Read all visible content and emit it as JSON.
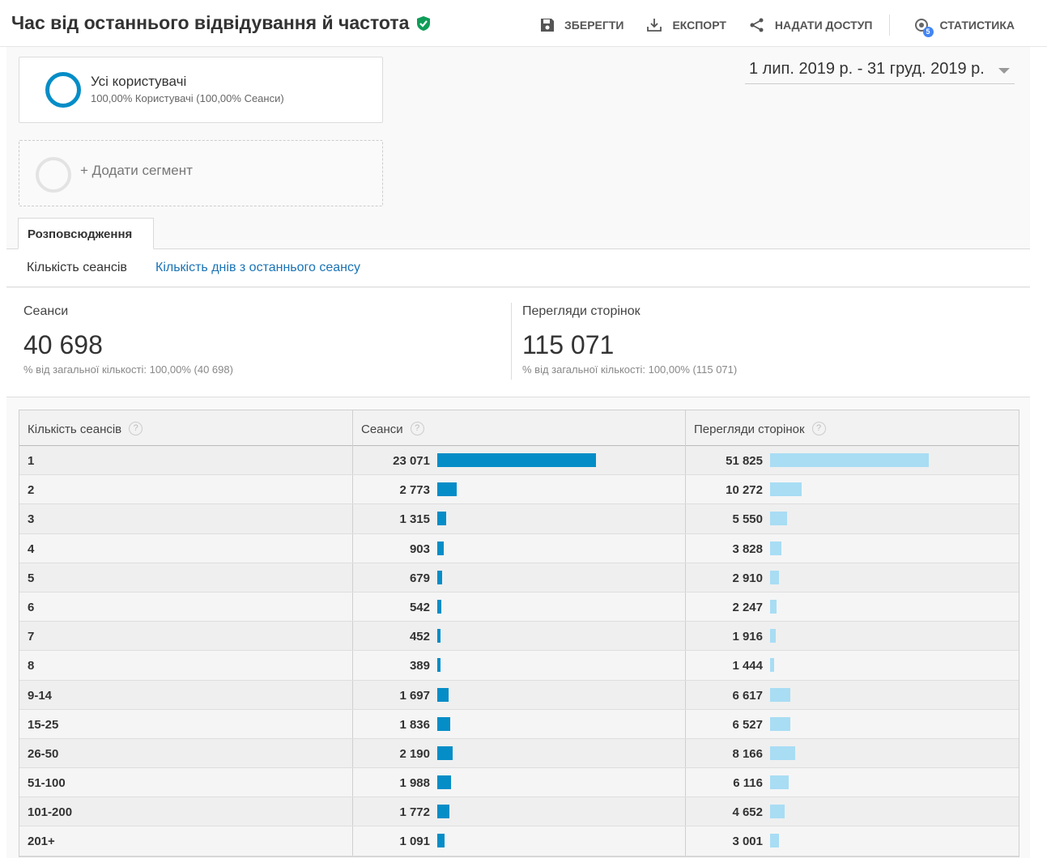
{
  "header": {
    "title": "Час від останнього відвідування й частота",
    "toolbar": {
      "save": "ЗБЕРЕГТИ",
      "export": "ЕКСПОРТ",
      "share": "НАДАТИ ДОСТУП",
      "insights": "СТАТИСТИКА",
      "insights_badge": "5"
    }
  },
  "segments": {
    "active": {
      "name": "Усі користувачі",
      "detail": "100,00% Користувачі (100,00% Сеанси)"
    },
    "add_label": "+ Додати сегмент"
  },
  "date_range": "1 лип. 2019 р. - 31 груд. 2019 р.",
  "tabs": {
    "active": "Розповсюдження"
  },
  "subnav": {
    "current": "Кількість сеансів",
    "link": "Кількість днів з останнього сеансу"
  },
  "scorecards": {
    "sessions": {
      "label": "Сеанси",
      "value": "40 698",
      "pct": "% від загальної кількості: 100,00% (40 698)"
    },
    "pageviews": {
      "label": "Перегляди сторінок",
      "value": "115 071",
      "pct": "% від загальної кількості: 100,00% (115 071)"
    }
  },
  "table": {
    "headers": [
      "Кількість сеансів",
      "Сеанси",
      "Перегляди сторінок"
    ],
    "help_glyph": "?",
    "rows": [
      {
        "label": "1",
        "sessions": "23 071",
        "sessions_v": 23071,
        "pageviews": "51 825",
        "pageviews_v": 51825
      },
      {
        "label": "2",
        "sessions": "2 773",
        "sessions_v": 2773,
        "pageviews": "10 272",
        "pageviews_v": 10272
      },
      {
        "label": "3",
        "sessions": "1 315",
        "sessions_v": 1315,
        "pageviews": "5 550",
        "pageviews_v": 5550
      },
      {
        "label": "4",
        "sessions": "903",
        "sessions_v": 903,
        "pageviews": "3 828",
        "pageviews_v": 3828
      },
      {
        "label": "5",
        "sessions": "679",
        "sessions_v": 679,
        "pageviews": "2 910",
        "pageviews_v": 2910
      },
      {
        "label": "6",
        "sessions": "542",
        "sessions_v": 542,
        "pageviews": "2 247",
        "pageviews_v": 2247
      },
      {
        "label": "7",
        "sessions": "452",
        "sessions_v": 452,
        "pageviews": "1 916",
        "pageviews_v": 1916
      },
      {
        "label": "8",
        "sessions": "389",
        "sessions_v": 389,
        "pageviews": "1 444",
        "pageviews_v": 1444
      },
      {
        "label": "9-14",
        "sessions": "1 697",
        "sessions_v": 1697,
        "pageviews": "6 617",
        "pageviews_v": 6617
      },
      {
        "label": "15-25",
        "sessions": "1 836",
        "sessions_v": 1836,
        "pageviews": "6 527",
        "pageviews_v": 6527
      },
      {
        "label": "26-50",
        "sessions": "2 190",
        "sessions_v": 2190,
        "pageviews": "8 166",
        "pageviews_v": 8166
      },
      {
        "label": "51-100",
        "sessions": "1 988",
        "sessions_v": 1988,
        "pageviews": "6 116",
        "pageviews_v": 6116
      },
      {
        "label": "101-200",
        "sessions": "1 772",
        "sessions_v": 1772,
        "pageviews": "4 652",
        "pageviews_v": 4652
      },
      {
        "label": "201+",
        "sessions": "1 091",
        "sessions_v": 1091,
        "pageviews": "3 001",
        "pageviews_v": 3001
      }
    ]
  },
  "colors": {
    "sessions_bar": "#058dc7",
    "pageviews_bar": "#a8ddf4",
    "verified": "#0f9d58",
    "link": "#1a73b5"
  }
}
